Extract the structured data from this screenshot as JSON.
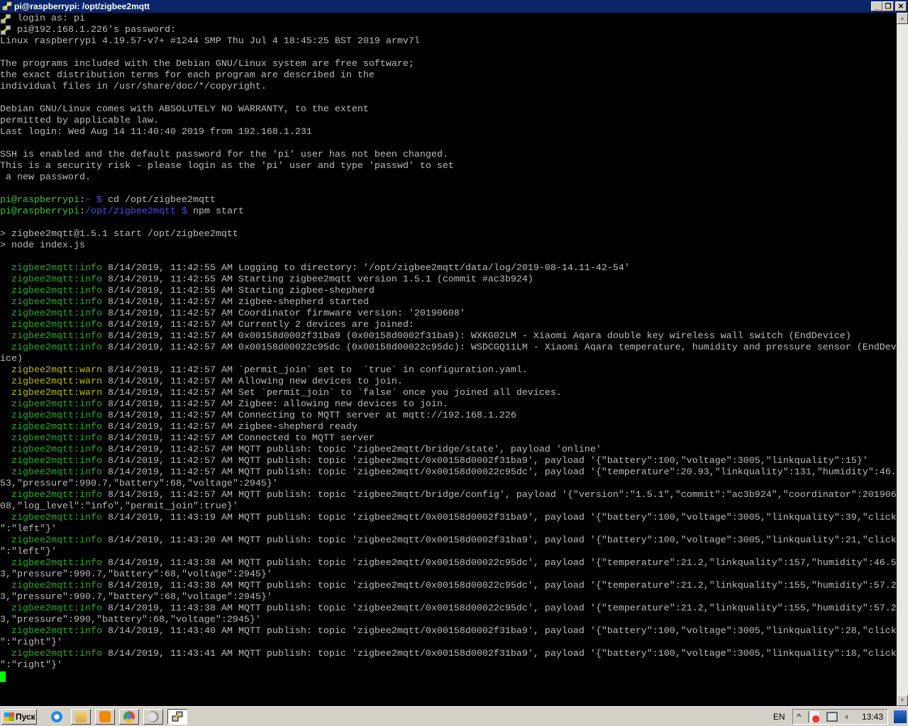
{
  "window": {
    "title": "pi@raspberrypi: /opt/zigbee2mqtt",
    "buttons": {
      "minimize": "_",
      "restore": "❐",
      "close": "✕"
    }
  },
  "terminal": {
    "lines": [
      {
        "icon": "putty-icon",
        "s": [
          [
            " login as: pi",
            ""
          ]
        ]
      },
      {
        "icon": "putty-icon",
        "s": [
          [
            " pi@192.168.1.226's password:",
            ""
          ]
        ]
      },
      {
        "s": [
          [
            "Linux raspberrypi 4.19.57-v7+ #1244 SMP Thu Jul 4 18:45:25 BST 2019 armv7l",
            ""
          ]
        ]
      },
      {
        "s": []
      },
      {
        "s": [
          [
            "The programs included with the Debian GNU/Linux system are free software;",
            ""
          ]
        ]
      },
      {
        "s": [
          [
            "the exact distribution terms for each program are described in the",
            ""
          ]
        ]
      },
      {
        "s": [
          [
            "individual files in /usr/share/doc/*/copyright.",
            ""
          ]
        ]
      },
      {
        "s": []
      },
      {
        "s": [
          [
            "Debian GNU/Linux comes with ABSOLUTELY NO WARRANTY, to the extent",
            ""
          ]
        ]
      },
      {
        "s": [
          [
            "permitted by applicable law.",
            ""
          ]
        ]
      },
      {
        "s": [
          [
            "Last login: Wed Aug 14 11:40:40 2019 from 192.168.1.231",
            ""
          ]
        ]
      },
      {
        "s": []
      },
      {
        "s": [
          [
            "SSH is enabled and the default password for the 'pi' user has not been changed.",
            ""
          ]
        ]
      },
      {
        "s": [
          [
            "This is a security risk - please login as the 'pi' user and type 'passwd' to set",
            ""
          ]
        ]
      },
      {
        "s": [
          [
            " a new password.",
            ""
          ]
        ]
      },
      {
        "s": []
      },
      {
        "s": [
          [
            "pi@raspberrypi",
            "pu"
          ],
          [
            ":",
            ""
          ],
          [
            "~ $",
            "pb"
          ],
          [
            " cd /opt/zigbee2mqtt",
            ""
          ]
        ]
      },
      {
        "s": [
          [
            "pi@raspberrypi",
            "pu"
          ],
          [
            ":",
            ""
          ],
          [
            "/opt/zigbee2mqtt $",
            "pb"
          ],
          [
            " npm start",
            ""
          ]
        ]
      },
      {
        "s": []
      },
      {
        "s": [
          [
            "> zigbee2mqtt@1.5.1 start /opt/zigbee2mqtt",
            ""
          ]
        ]
      },
      {
        "s": [
          [
            "> node index.js",
            ""
          ]
        ]
      },
      {
        "s": []
      },
      {
        "s": [
          [
            "  ",
            ""
          ],
          [
            "zigbee2mqtt:info",
            "g"
          ],
          [
            " 8/14/2019, 11:42:55 AM Logging to directory: '/opt/zigbee2mqtt/data/log/2019-08-14.11-42-54'",
            ""
          ]
        ]
      },
      {
        "s": [
          [
            "  ",
            ""
          ],
          [
            "zigbee2mqtt:info",
            "g"
          ],
          [
            " 8/14/2019, 11:42:55 AM Starting zigbee2mqtt version 1.5.1 (commit #ac3b924)",
            ""
          ]
        ]
      },
      {
        "s": [
          [
            "  ",
            ""
          ],
          [
            "zigbee2mqtt:info",
            "g"
          ],
          [
            " 8/14/2019, 11:42:55 AM Starting zigbee-shepherd",
            ""
          ]
        ]
      },
      {
        "s": [
          [
            "  ",
            ""
          ],
          [
            "zigbee2mqtt:info",
            "g"
          ],
          [
            " 8/14/2019, 11:42:57 AM zigbee-shepherd started",
            ""
          ]
        ]
      },
      {
        "s": [
          [
            "  ",
            ""
          ],
          [
            "zigbee2mqtt:info",
            "g"
          ],
          [
            " 8/14/2019, 11:42:57 AM Coordinator firmware version: '20190608'",
            ""
          ]
        ]
      },
      {
        "s": [
          [
            "  ",
            ""
          ],
          [
            "zigbee2mqtt:info",
            "g"
          ],
          [
            " 8/14/2019, 11:42:57 AM Currently 2 devices are joined:",
            ""
          ]
        ]
      },
      {
        "s": [
          [
            "  ",
            ""
          ],
          [
            "zigbee2mqtt:info",
            "g"
          ],
          [
            " 8/14/2019, 11:42:57 AM 0x00158d0002f31ba9 (0x00158d0002f31ba9): WXKG02LM - Xiaomi Aqara double key wireless wall switch (EndDevice)",
            ""
          ]
        ]
      },
      {
        "s": [
          [
            "  ",
            ""
          ],
          [
            "zigbee2mqtt:info",
            "g"
          ],
          [
            " 8/14/2019, 11:42:57 AM 0x00158d00022c95dc (0x00158d00022c95dc): WSDCGQ11LM - Xiaomi Aqara temperature, humidity and pressure sensor (EndDev",
            ""
          ]
        ]
      },
      {
        "s": [
          [
            "ice)",
            ""
          ]
        ]
      },
      {
        "s": [
          [
            "  ",
            ""
          ],
          [
            "zigbee2mqtt:warn",
            "y"
          ],
          [
            " 8/14/2019, 11:42:57 AM `permit_join` set to  `true` in configuration.yaml.",
            ""
          ]
        ]
      },
      {
        "s": [
          [
            "  ",
            ""
          ],
          [
            "zigbee2mqtt:warn",
            "y"
          ],
          [
            " 8/14/2019, 11:42:57 AM Allowing new devices to join.",
            ""
          ]
        ]
      },
      {
        "s": [
          [
            "  ",
            ""
          ],
          [
            "zigbee2mqtt:warn",
            "y"
          ],
          [
            " 8/14/2019, 11:42:57 AM Set `permit_join` to `false` once you joined all devices.",
            ""
          ]
        ]
      },
      {
        "s": [
          [
            "  ",
            ""
          ],
          [
            "zigbee2mqtt:info",
            "g"
          ],
          [
            " 8/14/2019, 11:42:57 AM Zigbee: allowing new devices to join.",
            ""
          ]
        ]
      },
      {
        "s": [
          [
            "  ",
            ""
          ],
          [
            "zigbee2mqtt:info",
            "g"
          ],
          [
            " 8/14/2019, 11:42:57 AM Connecting to MQTT server at mqtt://192.168.1.226",
            ""
          ]
        ]
      },
      {
        "s": [
          [
            "  ",
            ""
          ],
          [
            "zigbee2mqtt:info",
            "g"
          ],
          [
            " 8/14/2019, 11:42:57 AM zigbee-shepherd ready",
            ""
          ]
        ]
      },
      {
        "s": [
          [
            "  ",
            ""
          ],
          [
            "zigbee2mqtt:info",
            "g"
          ],
          [
            " 8/14/2019, 11:42:57 AM Connected to MQTT server",
            ""
          ]
        ]
      },
      {
        "s": [
          [
            "  ",
            ""
          ],
          [
            "zigbee2mqtt:info",
            "g"
          ],
          [
            " 8/14/2019, 11:42:57 AM MQTT publish: topic 'zigbee2mqtt/bridge/state', payload 'online'",
            ""
          ]
        ]
      },
      {
        "s": [
          [
            "  ",
            ""
          ],
          [
            "zigbee2mqtt:info",
            "g"
          ],
          [
            " 8/14/2019, 11:42:57 AM MQTT publish: topic 'zigbee2mqtt/0x00158d0002f31ba9', payload '{\"battery\":100,\"voltage\":3005,\"linkquality\":15}'",
            ""
          ]
        ]
      },
      {
        "s": [
          [
            "  ",
            ""
          ],
          [
            "zigbee2mqtt:info",
            "g"
          ],
          [
            " 8/14/2019, 11:42:57 AM MQTT publish: topic 'zigbee2mqtt/0x00158d00022c95dc', payload '{\"temperature\":20.93,\"linkquality\":131,\"humidity\":46.",
            ""
          ]
        ]
      },
      {
        "s": [
          [
            "53,\"pressure\":990.7,\"battery\":68,\"voltage\":2945}'",
            ""
          ]
        ]
      },
      {
        "s": [
          [
            "  ",
            ""
          ],
          [
            "zigbee2mqtt:info",
            "g"
          ],
          [
            " 8/14/2019, 11:42:57 AM MQTT publish: topic 'zigbee2mqtt/bridge/config', payload '{\"version\":\"1.5.1\",\"commit\":\"ac3b924\",\"coordinator\":201906",
            ""
          ]
        ]
      },
      {
        "s": [
          [
            "08,\"log_level\":\"info\",\"permit_join\":true}'",
            ""
          ]
        ]
      },
      {
        "s": [
          [
            "  ",
            ""
          ],
          [
            "zigbee2mqtt:info",
            "g"
          ],
          [
            " 8/14/2019, 11:43:19 AM MQTT publish: topic 'zigbee2mqtt/0x00158d0002f31ba9', payload '{\"battery\":100,\"voltage\":3005,\"linkquality\":39,\"click",
            ""
          ]
        ]
      },
      {
        "s": [
          [
            "\":\"left\"}'",
            ""
          ]
        ]
      },
      {
        "s": [
          [
            "  ",
            ""
          ],
          [
            "zigbee2mqtt:info",
            "g"
          ],
          [
            " 8/14/2019, 11:43:20 AM MQTT publish: topic 'zigbee2mqtt/0x00158d0002f31ba9', payload '{\"battery\":100,\"voltage\":3005,\"linkquality\":21,\"click",
            ""
          ]
        ]
      },
      {
        "s": [
          [
            "\":\"left\"}'",
            ""
          ]
        ]
      },
      {
        "s": [
          [
            "  ",
            ""
          ],
          [
            "zigbee2mqtt:info",
            "g"
          ],
          [
            " 8/14/2019, 11:43:38 AM MQTT publish: topic 'zigbee2mqtt/0x00158d00022c95dc', payload '{\"temperature\":21.2,\"linkquality\":157,\"humidity\":46.5",
            ""
          ]
        ]
      },
      {
        "s": [
          [
            "3,\"pressure\":990.7,\"battery\":68,\"voltage\":2945}'",
            ""
          ]
        ]
      },
      {
        "s": [
          [
            "  ",
            ""
          ],
          [
            "zigbee2mqtt:info",
            "g"
          ],
          [
            " 8/14/2019, 11:43:38 AM MQTT publish: topic 'zigbee2mqtt/0x00158d00022c95dc', payload '{\"temperature\":21.2,\"linkquality\":155,\"humidity\":57.2",
            ""
          ]
        ]
      },
      {
        "s": [
          [
            "3,\"pressure\":990.7,\"battery\":68,\"voltage\":2945}'",
            ""
          ]
        ]
      },
      {
        "s": [
          [
            "  ",
            ""
          ],
          [
            "zigbee2mqtt:info",
            "g"
          ],
          [
            " 8/14/2019, 11:43:38 AM MQTT publish: topic 'zigbee2mqtt/0x00158d00022c95dc', payload '{\"temperature\":21.2,\"linkquality\":155,\"humidity\":57.2",
            ""
          ]
        ]
      },
      {
        "s": [
          [
            "3,\"pressure\":990,\"battery\":68,\"voltage\":2945}'",
            ""
          ]
        ]
      },
      {
        "s": [
          [
            "  ",
            ""
          ],
          [
            "zigbee2mqtt:info",
            "g"
          ],
          [
            " 8/14/2019, 11:43:40 AM MQTT publish: topic 'zigbee2mqtt/0x00158d0002f31ba9', payload '{\"battery\":100,\"voltage\":3005,\"linkquality\":28,\"click",
            ""
          ]
        ]
      },
      {
        "s": [
          [
            "\":\"right\"}'",
            ""
          ]
        ]
      },
      {
        "s": [
          [
            "  ",
            ""
          ],
          [
            "zigbee2mqtt:info",
            "g"
          ],
          [
            " 8/14/2019, 11:43:41 AM MQTT publish: topic 'zigbee2mqtt/0x00158d0002f31ba9', payload '{\"battery\":100,\"voltage\":3005,\"linkquality\":18,\"click",
            ""
          ]
        ]
      },
      {
        "s": [
          [
            "\":\"right\"}'",
            ""
          ]
        ]
      }
    ]
  },
  "taskbar": {
    "start_label": "Пуск",
    "lang": "EN",
    "clock": "13:43",
    "tray_expand": "^"
  },
  "colors": {
    "info": "#1fb01f",
    "warn": "#bbbb00",
    "text": "#bbbbbb",
    "cursor": "#00ff00"
  }
}
